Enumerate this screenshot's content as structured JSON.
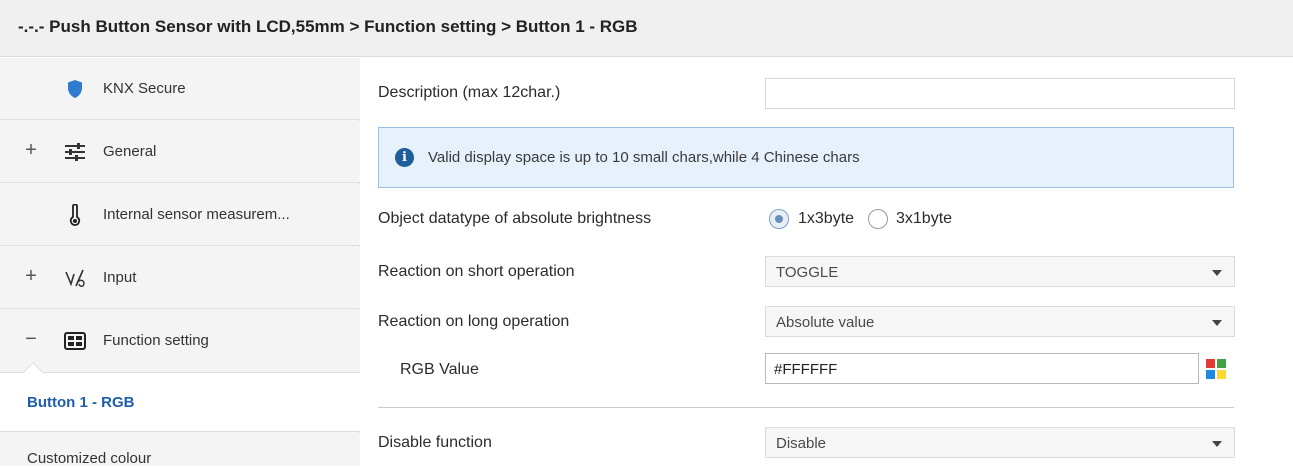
{
  "window": {
    "title": "-.-.- Push Button Sensor with LCD,55mm > Function setting > Button 1 - RGB"
  },
  "sidebar": {
    "items": [
      {
        "label": "KNX Secure",
        "icon": "shield-icon",
        "expander": ""
      },
      {
        "label": "General",
        "icon": "sliders-icon",
        "expander": "+"
      },
      {
        "label": "Internal sensor measurem...",
        "icon": "thermometer-icon",
        "expander": ""
      },
      {
        "label": "Input",
        "icon": "input-icon",
        "expander": "+"
      },
      {
        "label": "Function setting",
        "icon": "grid-icon",
        "expander": "−"
      }
    ],
    "subitems": [
      {
        "label": "Button 1 - RGB",
        "active": true
      },
      {
        "label": "Customized colour",
        "active": false
      }
    ]
  },
  "params": {
    "description": {
      "label": "Description (max 12char.)",
      "value": ""
    },
    "info": {
      "text": "Valid display space is up to 10 small chars,while 4 Chinese chars",
      "icon": "info-icon"
    },
    "datatype": {
      "label": "Object datatype of absolute brightness",
      "options": [
        "1x3byte",
        "3x1byte"
      ],
      "selected": "1x3byte"
    },
    "short_op": {
      "label": "Reaction on short operation",
      "value": "TOGGLE"
    },
    "long_op": {
      "label": "Reaction on long operation",
      "value": "Absolute value"
    },
    "rgb": {
      "label": "RGB Value",
      "value": "#FFFFFF",
      "icon": "color-palette-icon"
    },
    "disable": {
      "label": "Disable function",
      "value": "Disable"
    }
  },
  "colors": {
    "accent": "#1e5fa8",
    "info_bg": "#e7f1fb",
    "info_border": "#9bbfe0",
    "palette": [
      "#e53935",
      "#43a047",
      "#1e88e5",
      "#fdd835"
    ]
  }
}
